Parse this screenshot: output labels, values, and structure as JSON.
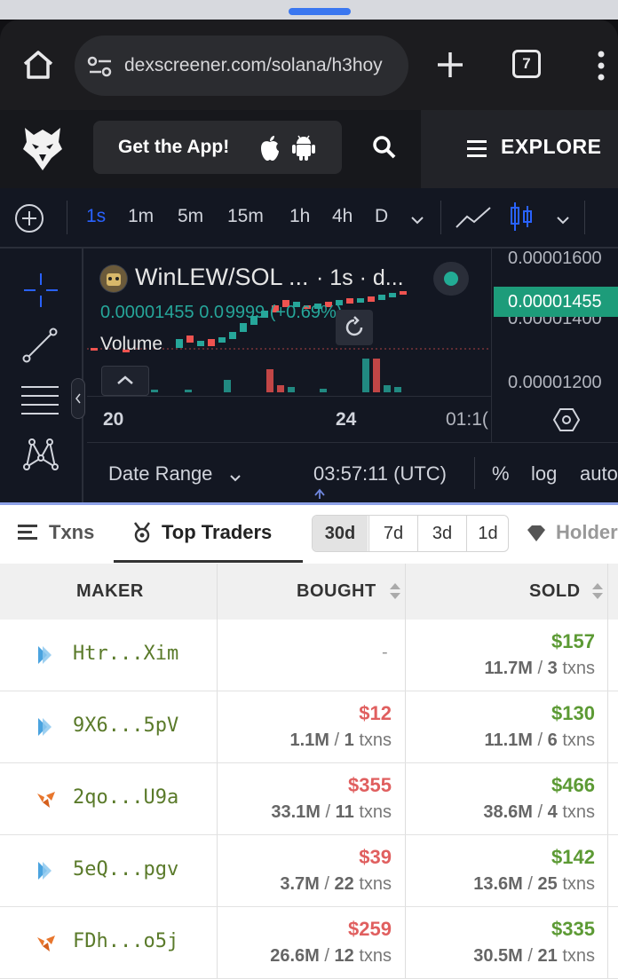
{
  "browser": {
    "url": "dexscreener.com/solana/h3hoy",
    "tab_count": "7"
  },
  "header": {
    "app_button_label": "Get the App!",
    "explore_label": "EXPLORE"
  },
  "chart_toolbar": {
    "timeframes": [
      "1s",
      "1m",
      "5m",
      "15m",
      "1h",
      "4h",
      "D"
    ],
    "active_timeframe": "1s"
  },
  "chart": {
    "pair_title": "WinLEW/SOL ...",
    "interval_info": "· 1s · d...",
    "ohlc_line": "0.00001455  0.0 9999 (+0.69%)",
    "volume_label": "Volume",
    "price_labels": [
      "0.00001600",
      "0.00001400",
      "0.00001200"
    ],
    "current_price": "0.00001455",
    "time_labels": [
      "20",
      "24",
      "01:1("
    ],
    "date_range_label": "Date Range",
    "clock": "03:57:11 (UTC)",
    "percent_label": "%",
    "log_label": "log",
    "auto_label": "auto"
  },
  "panel": {
    "tabs": {
      "txns": "Txns",
      "top_traders": "Top Traders",
      "holders": "Holder"
    },
    "periods": [
      "30d",
      "7d",
      "3d",
      "1d"
    ],
    "active_period": "30d",
    "columns": {
      "maker": "MAKER",
      "bought": "BOUGHT",
      "sold": "SOLD"
    },
    "rows": [
      {
        "maker": "Htr...Xim",
        "icon": "phantom-icon",
        "bought_usd": "-",
        "bought_tokens": "",
        "bought_txns": "",
        "sold_usd": "$157",
        "sold_tokens": "11.7M",
        "sold_txns": "3"
      },
      {
        "maker": "9X6...5pV",
        "icon": "phantom-icon",
        "bought_usd": "$12",
        "bought_tokens": "1.1M",
        "bought_txns": "1",
        "sold_usd": "$130",
        "sold_tokens": "11.1M",
        "sold_txns": "6"
      },
      {
        "maker": "2qo...U9a",
        "icon": "metamask-icon",
        "bought_usd": "$355",
        "bought_tokens": "33.1M",
        "bought_txns": "11",
        "sold_usd": "$466",
        "sold_tokens": "38.6M",
        "sold_txns": "4"
      },
      {
        "maker": "5eQ...pgv",
        "icon": "phantom-icon",
        "bought_usd": "$39",
        "bought_tokens": "3.7M",
        "bought_txns": "22",
        "sold_usd": "$142",
        "sold_tokens": "13.6M",
        "sold_txns": "25"
      },
      {
        "maker": "FDh...o5j",
        "icon": "metamask-icon",
        "bought_usd": "$259",
        "bought_tokens": "26.6M",
        "bought_txns": "12",
        "sold_usd": "$335",
        "sold_tokens": "30.5M",
        "sold_txns": "21"
      }
    ],
    "txns_word": "txns"
  },
  "colors": {
    "up": "#26a69a",
    "down": "#ef5350",
    "accent": "#2962ff"
  }
}
